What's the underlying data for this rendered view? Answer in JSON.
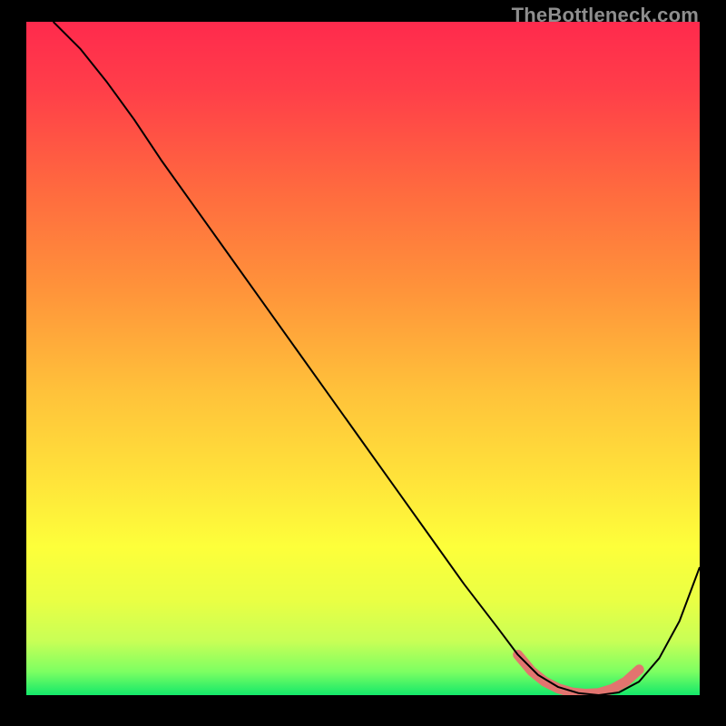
{
  "watermark": "TheBottleneck.com",
  "chart_data": {
    "type": "line",
    "title": "",
    "xlabel": "",
    "ylabel": "",
    "xlim": [
      0,
      100
    ],
    "ylim": [
      0,
      100
    ],
    "grid": false,
    "legend": false,
    "background_gradient": {
      "top": "#ff2a4d",
      "upper_mid": "#ff7a3c",
      "mid": "#ffd23a",
      "lower_mid": "#f7ff3a",
      "near_bottom": "#c8ff5a",
      "bottom": "#17e86a"
    },
    "series": [
      {
        "name": "bottleneck-curve",
        "stroke": "#000000",
        "stroke_width": 2,
        "x": [
          4,
          8,
          12,
          16,
          20,
          25,
          30,
          35,
          40,
          45,
          50,
          55,
          60,
          65,
          70,
          73,
          76,
          79,
          82,
          85,
          88,
          91,
          94,
          97,
          100
        ],
        "y": [
          100,
          96,
          91,
          85.5,
          79.5,
          72.5,
          65.5,
          58.5,
          51.5,
          44.5,
          37.5,
          30.5,
          23.5,
          16.5,
          10,
          6,
          3,
          1.2,
          0.3,
          0,
          0.4,
          2,
          5.5,
          11,
          19
        ]
      },
      {
        "name": "optimal-range-marker",
        "stroke": "#e2746f",
        "stroke_width": 11,
        "linecap": "round",
        "x": [
          73,
          75,
          77,
          79,
          81,
          83,
          85,
          87,
          89,
          91
        ],
        "y": [
          6.0,
          3.6,
          2.0,
          1.0,
          0.4,
          0.2,
          0.3,
          0.9,
          2.0,
          3.8
        ]
      }
    ]
  }
}
